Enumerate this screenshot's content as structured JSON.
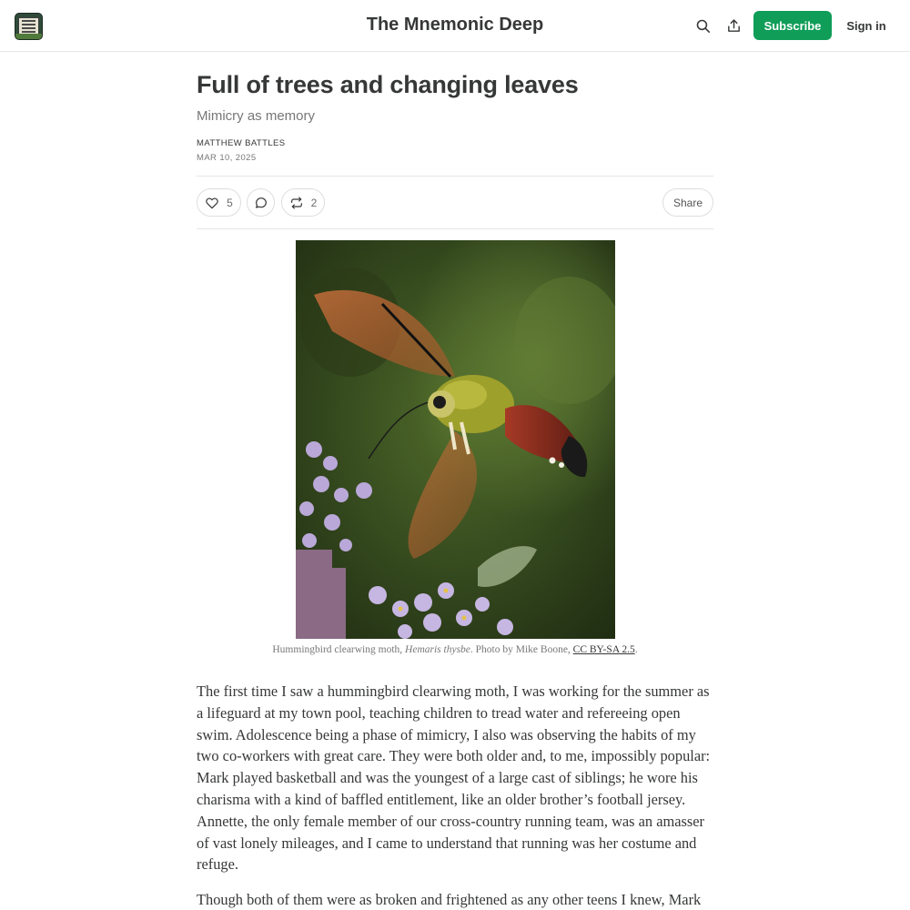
{
  "header": {
    "site_title": "The Mnemonic Deep",
    "subscribe_label": "Subscribe",
    "signin_label": "Sign in",
    "logo_icon": "site-logo-sign-icon",
    "search_icon": "search-icon",
    "share_icon": "upload-share-icon"
  },
  "post": {
    "title": "Full of trees and changing leaves",
    "subtitle": "Mimicry as memory",
    "author": "MATTHEW BATTLES",
    "date": "MAR 10, 2025"
  },
  "actions": {
    "likes": "5",
    "restacks": "2",
    "share_label": "Share"
  },
  "figure": {
    "caption_prefix": "Hummingbird clearwing moth, ",
    "caption_species": "Hemaris thysbe",
    "caption_credit": ". Photo by Mike Boone, ",
    "caption_license": "CC BY-SA 2.5",
    "caption_end": "."
  },
  "body": {
    "paragraph_1": "The first time I saw a hummingbird clearwing moth, I was working for the summer as a lifeguard at my town pool, teaching children to tread water and refereeing open swim. Adolescence being a phase of mimicry, I also was observing the habits of my two co-workers with great care. They were both older and, to me, impossibly popular: Mark played basketball and was the youngest of a large cast of siblings; he wore his charisma with a kind of baffled entitlement, like an older brother’s football jersey. Annette, the only female member of our cross-country running team, was an amasser of vast lonely mileages, and I came to understand that running was her costume and refuge.",
    "paragraph_2": "Though both of them were as broken and frightened as any other teens I knew, Mark"
  },
  "colors": {
    "accent": "#0f9d58",
    "text": "#363737",
    "muted": "#777777",
    "divider": "#e6e6e6"
  }
}
